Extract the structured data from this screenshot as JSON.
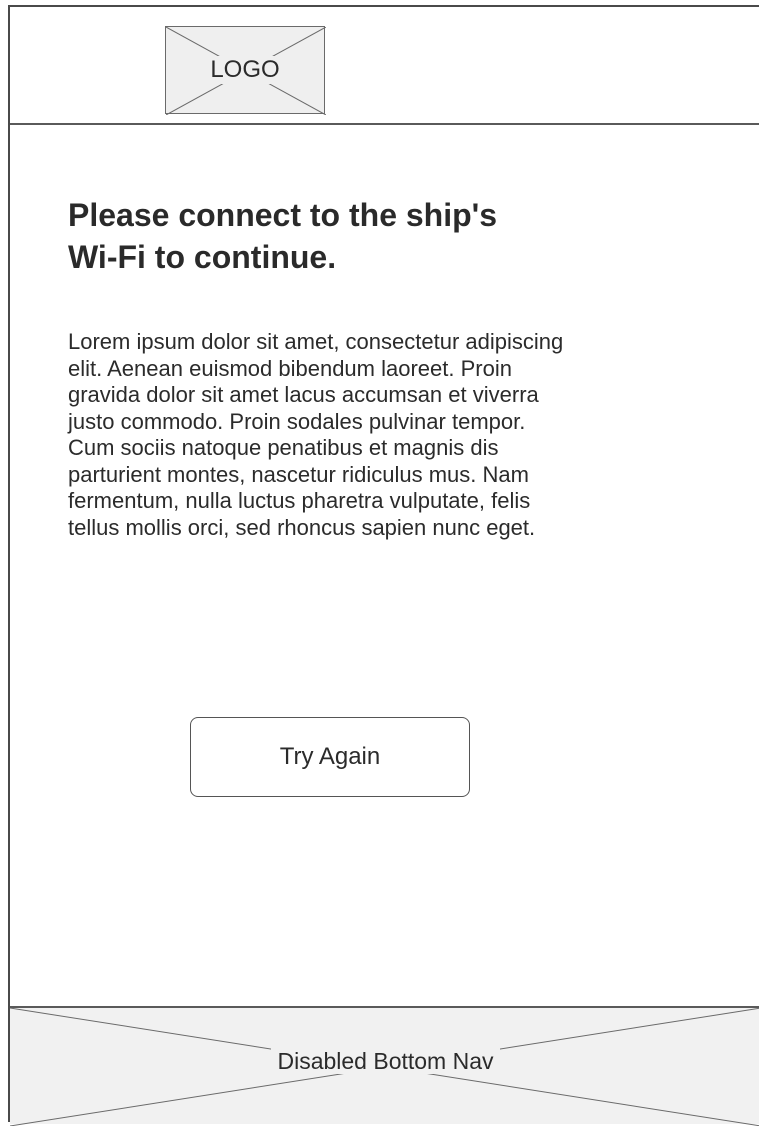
{
  "header": {
    "logo_label": "LOGO"
  },
  "main": {
    "heading_line1": "Please connect to the ship's",
    "heading_line2": "Wi-Fi to continue.",
    "body_lines": [
      "Lorem ipsum dolor sit amet, consectetur adipiscing",
      "elit. Aenean euismod bibendum laoreet. Proin",
      "gravida dolor sit amet lacus accumsan et viverra",
      "justo commodo. Proin sodales pulvinar tempor.",
      "Cum sociis natoque penatibus et magnis dis",
      "parturient montes, nascetur ridiculus mus. Nam",
      "fermentum, nulla luctus pharetra vulputate, felis",
      "tellus mollis orci, sed rhoncus sapien nunc eget."
    ],
    "try_again_label": "Try Again"
  },
  "bottom_nav": {
    "label": "Disabled Bottom Nav"
  }
}
